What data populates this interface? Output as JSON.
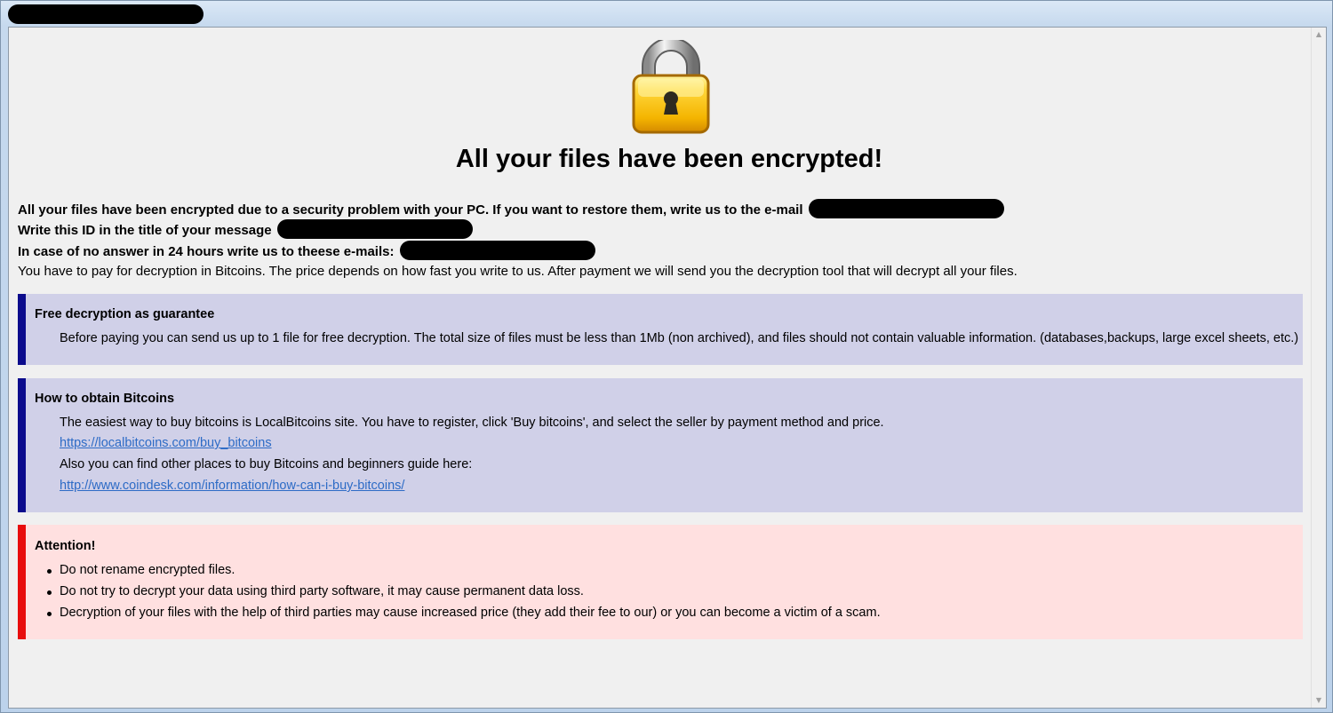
{
  "headline": "All your files have been encrypted!",
  "lines": {
    "line1": "All your files have been encrypted due to a security problem with your PC. If you want to restore them, write us to the e-mail",
    "line2": "Write this ID in the title of your message",
    "line3": "In case of no answer in 24 hours write us to theese e-mails:",
    "line4": "You have to pay for decryption in Bitcoins. The price depends on how fast you write to us. After payment we will send you the decryption tool that will decrypt all your files."
  },
  "guarantee": {
    "title": "Free decryption as guarantee",
    "text": "Before paying you can send us up to 1 file for free decryption. The total size of files must be less than 1Mb (non archived), and files should not contain valuable information. (databases,backups, large excel sheets, etc.)"
  },
  "bitcoins": {
    "title": "How to obtain Bitcoins",
    "text1": "The easiest way to buy bitcoins is LocalBitcoins site. You have to register, click 'Buy bitcoins', and select the seller by payment method and price.",
    "link1": "https://localbitcoins.com/buy_bitcoins",
    "text2": "Also you can find other places to buy Bitcoins and beginners guide here:",
    "link2": "http://www.coindesk.com/information/how-can-i-buy-bitcoins/"
  },
  "attention": {
    "title": "Attention!",
    "items": [
      "Do not rename encrypted files.",
      "Do not try to decrypt your data using third party software, it may cause permanent data loss.",
      "Decryption of your files with the help of third parties may cause increased price (they add their fee to our) or you can become a victim of a scam."
    ]
  },
  "colors": {
    "info_box_bg": "#d0d0e8",
    "info_box_accent": "#0b0b8c",
    "attention_box_bg": "#ffe0e0",
    "attention_box_accent": "#e80d0d",
    "link": "#2d6bc6"
  },
  "icons": {
    "lock": "padlock-icon",
    "scroll_up": "scroll-up-arrow-icon",
    "scroll_down": "scroll-down-arrow-icon"
  }
}
